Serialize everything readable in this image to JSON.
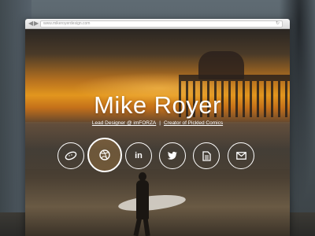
{
  "browser": {
    "url": "www.mikeroyerdesign.com",
    "back_glyph": "◀",
    "forward_glyph": "▶",
    "reload_glyph": "↻"
  },
  "hero": {
    "name": "Mike Royer",
    "role": "Lead Designer @ imFORZA",
    "separator": "|",
    "side_project": "Creator of Pickled Comics"
  },
  "social_links": [
    {
      "id": "pickle",
      "icon": "pickle-icon",
      "active": false
    },
    {
      "id": "dribbble",
      "icon": "dribbble-icon",
      "active": true
    },
    {
      "id": "linkedin",
      "icon": "linkedin-icon",
      "label": "in",
      "active": false
    },
    {
      "id": "twitter",
      "icon": "twitter-bird-icon",
      "active": false
    },
    {
      "id": "resume",
      "icon": "document-icon",
      "active": false
    },
    {
      "id": "email",
      "icon": "envelope-icon",
      "active": false
    }
  ],
  "colors": {
    "text": "#ffffff",
    "active_tint": "#e8a246",
    "sunset": "#e2961e"
  }
}
